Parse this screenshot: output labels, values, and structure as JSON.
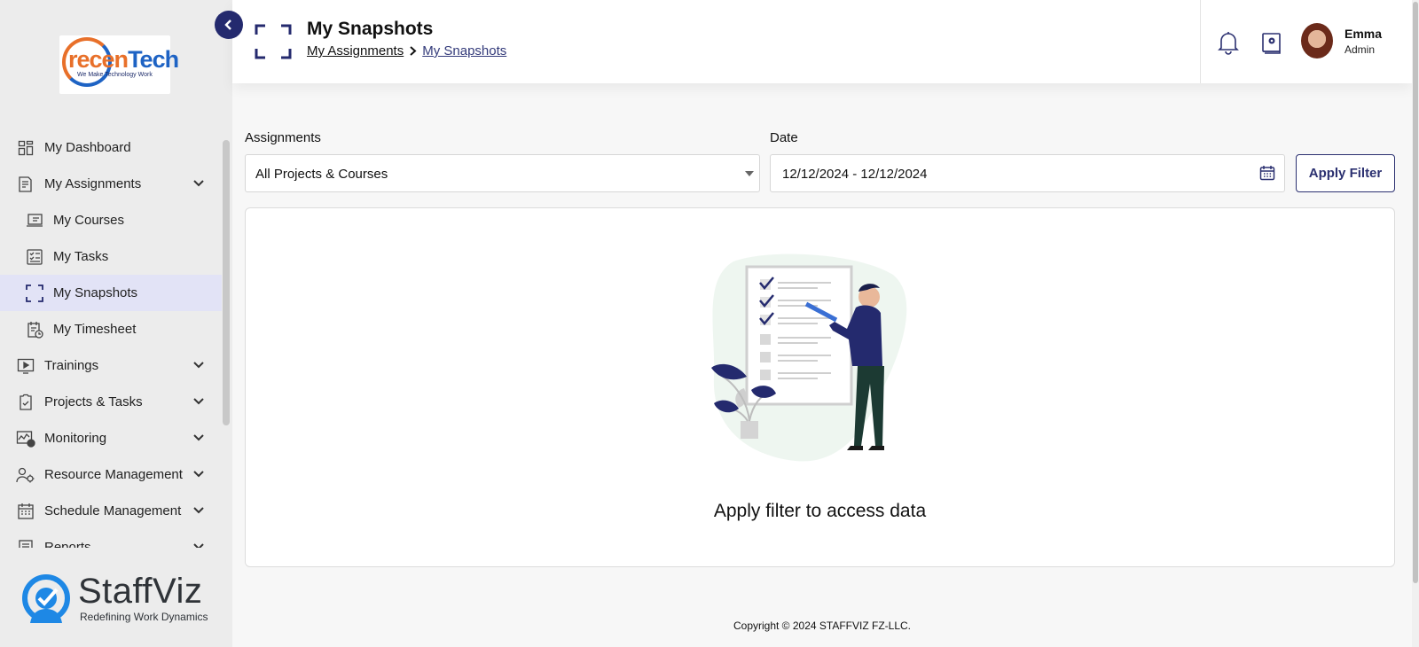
{
  "app": {
    "logo_text_a": "recen",
    "logo_text_b": "Tech",
    "logo_tagline": "We Make Technology Work",
    "footer_brand": "StaffViz",
    "footer_brand_tagline": "Redefining Work Dynamics"
  },
  "sidebar": {
    "items": [
      {
        "label": "My Dashboard",
        "icon": "dashboard-icon",
        "level": "top",
        "expandable": false
      },
      {
        "label": "My Assignments",
        "icon": "assignments-icon",
        "level": "top",
        "expandable": true
      },
      {
        "label": "My Courses",
        "icon": "courses-icon",
        "level": "sub",
        "expandable": false
      },
      {
        "label": "My Tasks",
        "icon": "tasks-icon",
        "level": "sub",
        "expandable": false
      },
      {
        "label": "My Snapshots",
        "icon": "snapshots-icon",
        "level": "sub",
        "expandable": false,
        "active": true
      },
      {
        "label": "My Timesheet",
        "icon": "timesheet-icon",
        "level": "sub",
        "expandable": false
      },
      {
        "label": "Trainings",
        "icon": "trainings-icon",
        "level": "top",
        "expandable": true
      },
      {
        "label": "Projects & Tasks",
        "icon": "projects-icon",
        "level": "top",
        "expandable": true
      },
      {
        "label": "Monitoring",
        "icon": "monitoring-icon",
        "level": "top",
        "expandable": true
      },
      {
        "label": "Resource Management",
        "icon": "resource-icon",
        "level": "top",
        "expandable": true
      },
      {
        "label": "Schedule Management",
        "icon": "schedule-icon",
        "level": "top",
        "expandable": true
      },
      {
        "label": "Reports",
        "icon": "reports-icon",
        "level": "top",
        "expandable": true
      }
    ]
  },
  "header": {
    "title": "My Snapshots",
    "breadcrumb": [
      "My Assignments",
      "My Snapshots"
    ],
    "user_name": "Emma",
    "user_role": "Admin"
  },
  "filters": {
    "assignments_label": "Assignments",
    "assignments_value": "All Projects & Courses",
    "date_label": "Date",
    "date_value": "12/12/2024 - 12/12/2024",
    "apply_label": "Apply Filter"
  },
  "panel": {
    "empty_message": "Apply filter to access data"
  },
  "footer": {
    "copyright": "Copyright © 2024 STAFFVIZ FZ-LLC."
  },
  "colors": {
    "accent": "#242a6e",
    "active_bg": "#e2e3f6",
    "sidebar_bg": "#ececec"
  }
}
